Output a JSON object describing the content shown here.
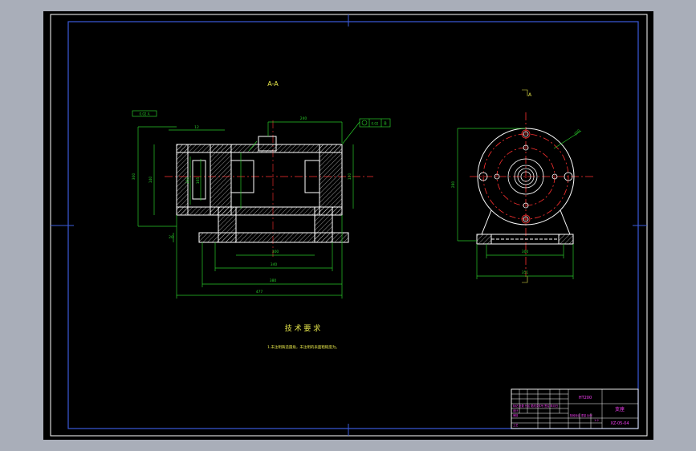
{
  "section_label": "A-A",
  "view_label": "A",
  "tech_title": "技 术 要 求",
  "tech_note": "1.未注明铸造圆角，未注明的表面粗糙度为。",
  "dims": {
    "overall_length": "477",
    "base_inner": "380",
    "base_mid": "340",
    "base_slot": "300",
    "top_span": "240",
    "flange_height": "140",
    "side_height": "300",
    "bore_diam": "120",
    "right_width": "351",
    "right_base": "300",
    "right_height": "280",
    "pcd": "250",
    "left_dim_a": "12",
    "left_dim_b": "160",
    "left_dim_c": "165",
    "left_dim_d": "20"
  },
  "frames": {
    "tolerance_left": "0.02 A",
    "tolerance_right": "0.02",
    "datum": "B"
  },
  "title_block": {
    "part_name": "HT200",
    "drawing_title": "支座",
    "drawing_no": "XZ-05-04",
    "scale_row": "1:2",
    "rows": [
      "标记 处数 分区 更改文件号 签名 年月日",
      "设计",
      "审核",
      "工艺",
      "阶段标记 重量 比例"
    ]
  },
  "colors": {
    "background_frame": "#a9aeb9",
    "sheet": "#000000",
    "border": "#3b5bdc",
    "outline": "#ffffff",
    "dimension": "#28c828",
    "center": "#ff3030",
    "text": "#e6e64a",
    "magenta": "#ff40ff"
  }
}
